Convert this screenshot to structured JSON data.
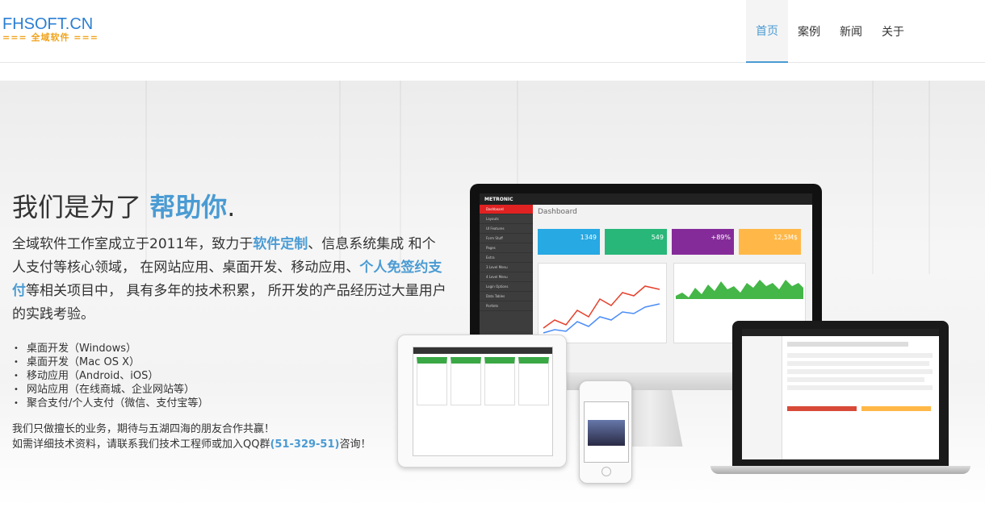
{
  "logo": {
    "line1": "FHSOFT.CN",
    "line2": "=== 全域软件 ==="
  },
  "nav": [
    {
      "label": "首页",
      "active": true
    },
    {
      "label": "案例",
      "active": false
    },
    {
      "label": "新闻",
      "active": false
    },
    {
      "label": "关于",
      "active": false
    }
  ],
  "hero": {
    "headline_prefix": "我们是为了 ",
    "headline_highlight": "帮助你",
    "headline_suffix": ".",
    "intro_part1": "全域软件工作室成立于2011年，致力于",
    "intro_hl1": "软件定制",
    "intro_part2": "、信息系统集成 和个人支付等核心领域， 在网站应用、桌面开发、移动应用、",
    "intro_hl2": "个人免签约支付",
    "intro_part3": "等相关项目中， 具有多年的技术积累， 所开发的产品经历过大量用户的实践考验。",
    "services": [
      "桌面开发（Windows）",
      "桌面开发（Mac OS X）",
      "移动应用（Android、iOS）",
      "网站应用（在线商城、企业网站等）",
      "聚合支付/个人支付（微信、支付宝等）"
    ],
    "contact_line1": "我们只做擅长的业务，期待与五湖四海的朋友合作共赢！",
    "contact_line2_prefix": "如需详细技术资料，请联系我们技术工程师或加入QQ群",
    "contact_qq": "(51-329-51)",
    "contact_line2_suffix": "咨询！"
  },
  "mockup": {
    "brand": "METRONIC",
    "dashboard_title": "Dashboard",
    "tiles": [
      {
        "value": "1349",
        "color": "#27a9e3"
      },
      {
        "value": "549",
        "color": "#28b779"
      },
      {
        "value": "+89%",
        "color": "#852b99"
      },
      {
        "value": "12,5M$",
        "color": "#ffb848"
      }
    ]
  },
  "colors": {
    "accent": "#4a9bd3",
    "logo_blue": "#2a7fd4",
    "logo_orange": "#f0a31c"
  }
}
